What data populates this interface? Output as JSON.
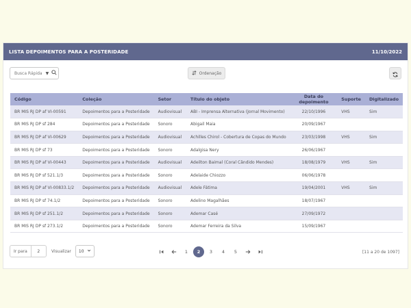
{
  "header": {
    "title": "LISTA DEPOIMENTOS PARA A POSTERIDADE",
    "date": "11/10/2022"
  },
  "toolbar": {
    "search_placeholder": "Busca Rápida",
    "order_label": "Ordenação",
    "icons": {
      "search": "search-icon",
      "order": "sort-icon",
      "refresh": "refresh-icon"
    }
  },
  "table": {
    "columns": [
      "Código",
      "Coleção",
      "Setor",
      "Título do objeto",
      "Data do depoimento",
      "Suporte",
      "Digitalizado"
    ],
    "rows": [
      [
        "BR MIS RJ DP af VI-00591",
        "Depoimentos para a Posteridade",
        "Audiovisual",
        "ABI - Imprensa Alternativa (Jornal Movimento)",
        "22/10/1996",
        "VHS",
        "Sim"
      ],
      [
        "BR MIS RJ DP sf 284",
        "Depoimentos para a Posteridade",
        "Sonoro",
        "Abigail Maia",
        "20/09/1967",
        "",
        ""
      ],
      [
        "BR MIS RJ DP af VI-00629",
        "Depoimentos para a Posteridade",
        "Audiovisual",
        "Achilles Chirol - Cobertura de Copas do Mundo",
        "23/03/1998",
        "VHS",
        "Sim"
      ],
      [
        "BR MIS RJ DP sf 73",
        "Depoimentos para a Posteridade",
        "Sonoro",
        "Adalgisa Nery",
        "26/06/1967",
        "",
        ""
      ],
      [
        "BR MIS RJ DP af VI-00443",
        "Depoimentos para a Posteridade",
        "Audiovisual",
        "Adeilton Baimal (Coral Cândido Mendes)",
        "18/08/1979",
        "VHS",
        "Sim"
      ],
      [
        "BR MIS RJ DP sf 521.1/3",
        "Depoimentos para a Posteridade",
        "Sonoro",
        "Adelaide Chiozzo",
        "06/06/1978",
        "",
        ""
      ],
      [
        "BR MIS RJ DP af VI-00833.1/2",
        "Depoimentos para a Posteridade",
        "Audiovisual",
        "Adele Fátima",
        "19/04/2001",
        "VHS",
        "Sim"
      ],
      [
        "BR MIS RJ DP sf 74.1/2",
        "Depoimentos para a Posteridade",
        "Sonoro",
        "Adelino Magalhães",
        "18/07/1967",
        "",
        ""
      ],
      [
        "BR MIS RJ DP sf 251.1/2",
        "Depoimentos para a Posteridade",
        "Sonoro",
        "Ademar Casé",
        "27/09/1972",
        "",
        ""
      ],
      [
        "BR MIS RJ DP sf 273.1/2",
        "Depoimentos para a Posteridade",
        "Sonoro",
        "Ademar Ferreira da Silva",
        "15/09/1967",
        "",
        ""
      ]
    ]
  },
  "footer": {
    "goto_label": "Ir para",
    "goto_value": "2",
    "view_label": "Visualizar",
    "view_value": "10",
    "pages": [
      "1",
      "2",
      "3",
      "4",
      "5"
    ],
    "active_page": "2",
    "range_text": "[11 a 20 de 1097]"
  },
  "colors": {
    "header": "#60688e",
    "table_header": "#aab0d6",
    "row_alt": "#e6e7f3",
    "background": "#fbfbe9"
  }
}
